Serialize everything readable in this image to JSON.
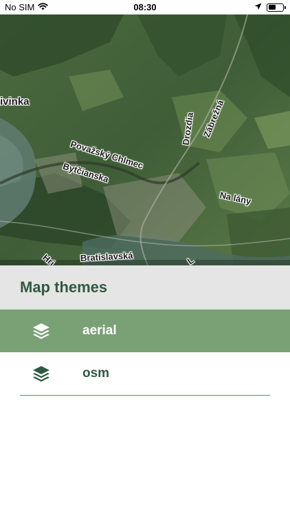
{
  "status_bar": {
    "carrier": "No SIM",
    "time": "08:30",
    "battery_level": 0.55
  },
  "map": {
    "labels": {
      "ivinka": "ivinka",
      "povazsky_chlmec": "Považský Chlmec",
      "byticianska": "Bytčianska",
      "drozdia": "Drozdia",
      "zabrezna": "Zábrežná",
      "na_lany": "Na lány",
      "bratislavska": "Bratislavská",
      "hri": "Hri",
      "l": "L"
    }
  },
  "themes_panel": {
    "title": "Map themes",
    "items": [
      {
        "label": "aerial",
        "selected": true,
        "icon": "layers-icon"
      },
      {
        "label": "osm",
        "selected": false,
        "icon": "layers-icon"
      }
    ]
  },
  "colors": {
    "accent_green": "#2f5a43",
    "selected_row": "#7aa175",
    "header_bg": "#e5e5e5"
  }
}
